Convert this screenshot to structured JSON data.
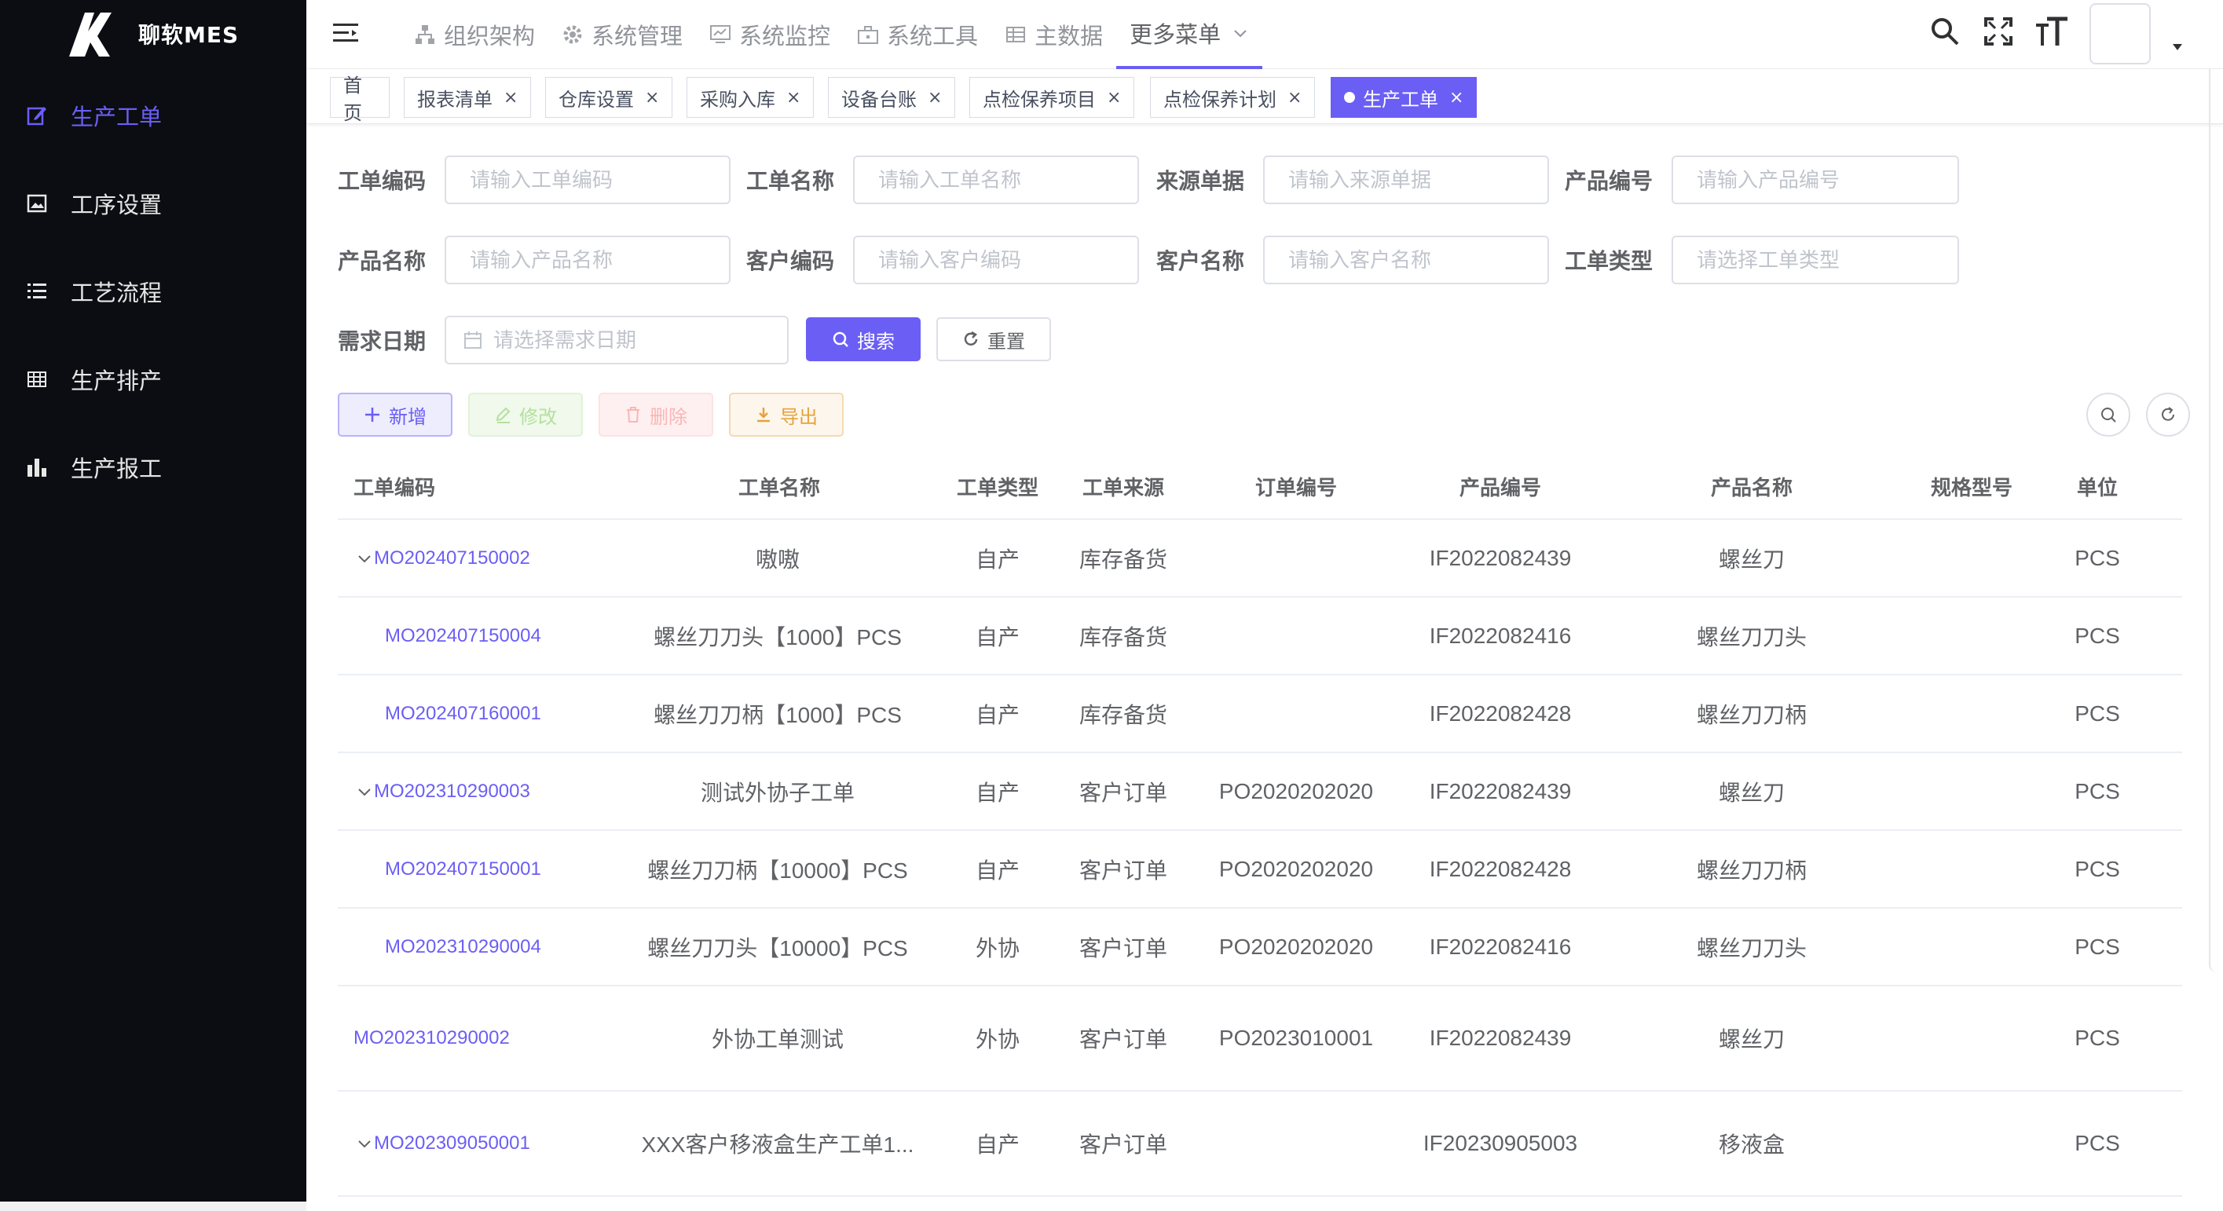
{
  "app": {
    "title": "聊软MES"
  },
  "sidebar": {
    "items": [
      {
        "label": "生产工单",
        "icon": "edit-icon",
        "active": true
      },
      {
        "label": "工序设置",
        "icon": "image-icon",
        "active": false
      },
      {
        "label": "工艺流程",
        "icon": "list-icon",
        "active": false
      },
      {
        "label": "生产排产",
        "icon": "table-icon",
        "active": false
      },
      {
        "label": "生产报工",
        "icon": "chart-icon",
        "active": false
      }
    ]
  },
  "navbar": {
    "menu": [
      {
        "label": "组织架构",
        "icon": "tree-icon"
      },
      {
        "label": "系统管理",
        "icon": "gear-icon"
      },
      {
        "label": "系统监控",
        "icon": "monitor-icon"
      },
      {
        "label": "系统工具",
        "icon": "toolbox-icon"
      },
      {
        "label": "主数据",
        "icon": "table-icon"
      },
      {
        "label": "更多菜单",
        "icon": "chevron-down-icon"
      }
    ],
    "right_icons": [
      "search-icon",
      "fullscreen-icon",
      "font-size-icon"
    ]
  },
  "tags": [
    {
      "label": "首页",
      "closable": false,
      "active": false
    },
    {
      "label": "报表清单",
      "closable": true,
      "active": false
    },
    {
      "label": "仓库设置",
      "closable": true,
      "active": false
    },
    {
      "label": "采购入库",
      "closable": true,
      "active": false
    },
    {
      "label": "设备台账",
      "closable": true,
      "active": false
    },
    {
      "label": "点检保养项目",
      "closable": true,
      "active": false
    },
    {
      "label": "点检保养计划",
      "closable": true,
      "active": false
    },
    {
      "label": "生产工单",
      "closable": true,
      "active": true
    }
  ],
  "tag_close": "×",
  "form": {
    "fields": [
      {
        "label": "工单编码",
        "placeholder": "请输入工单编码",
        "value": ""
      },
      {
        "label": "工单名称",
        "placeholder": "请输入工单名称",
        "value": ""
      },
      {
        "label": "来源单据",
        "placeholder": "请输入来源单据",
        "value": ""
      },
      {
        "label": "产品编号",
        "placeholder": "请输入产品编号",
        "value": ""
      },
      {
        "label": "产品名称",
        "placeholder": "请输入产品名称",
        "value": ""
      },
      {
        "label": "客户编码",
        "placeholder": "请输入客户编码",
        "value": ""
      },
      {
        "label": "客户名称",
        "placeholder": "请输入客户名称",
        "value": ""
      },
      {
        "label": "工单类型",
        "placeholder": "请选择工单类型",
        "value": ""
      }
    ],
    "date": {
      "label": "需求日期",
      "placeholder": "请选择需求日期"
    },
    "search_label": "搜索",
    "reset_label": "重置"
  },
  "toolbar": {
    "add_label": "新增",
    "edit_label": "修改",
    "delete_label": "删除",
    "export_label": "导出"
  },
  "table": {
    "columns": [
      "工单编码",
      "工单名称",
      "工单类型",
      "工单来源",
      "订单编号",
      "产品编号",
      "产品名称",
      "规格型号",
      "单位"
    ],
    "rows": [
      {
        "code": "MO202407150002",
        "name": "嗷嗷",
        "type": "自产",
        "source": "库存备货",
        "order": "",
        "product_code": "IF2022082439",
        "product_name": "螺丝刀",
        "spec": "",
        "unit": "PCS",
        "expandable": true,
        "level": 0
      },
      {
        "code": "MO202407150004",
        "name": "螺丝刀刀头【1000】PCS",
        "type": "自产",
        "source": "库存备货",
        "order": "",
        "product_code": "IF2022082416",
        "product_name": "螺丝刀刀头",
        "spec": "",
        "unit": "PCS",
        "expandable": false,
        "level": 1
      },
      {
        "code": "MO202407160001",
        "name": "螺丝刀刀柄【1000】PCS",
        "type": "自产",
        "source": "库存备货",
        "order": "",
        "product_code": "IF2022082428",
        "product_name": "螺丝刀刀柄",
        "spec": "",
        "unit": "PCS",
        "expandable": false,
        "level": 1
      },
      {
        "code": "MO202310290003",
        "name": "测试外协子工单",
        "type": "自产",
        "source": "客户订单",
        "order": "PO2020202020",
        "product_code": "IF2022082439",
        "product_name": "螺丝刀",
        "spec": "",
        "unit": "PCS",
        "expandable": true,
        "level": 0
      },
      {
        "code": "MO202407150001",
        "name": "螺丝刀刀柄【10000】PCS",
        "type": "自产",
        "source": "客户订单",
        "order": "PO2020202020",
        "product_code": "IF2022082428",
        "product_name": "螺丝刀刀柄",
        "spec": "",
        "unit": "PCS",
        "expandable": false,
        "level": 1
      },
      {
        "code": "MO202310290004",
        "name": "螺丝刀刀头【10000】PCS",
        "type": "外协",
        "source": "客户订单",
        "order": "PO2020202020",
        "product_code": "IF2022082416",
        "product_name": "螺丝刀刀头",
        "spec": "",
        "unit": "PCS",
        "expandable": false,
        "level": 1
      },
      {
        "code": "MO202310290002",
        "name": "外协工单测试",
        "type": "外协",
        "source": "客户订单",
        "order": "PO2023010001",
        "product_code": "IF2022082439",
        "product_name": "螺丝刀",
        "spec": "",
        "unit": "PCS",
        "expandable": false,
        "level": -1
      },
      {
        "code": "MO202309050001",
        "name": "XXX客户移液盒生产工单1...",
        "type": "自产",
        "source": "客户订单",
        "order": "",
        "product_code": "IF20230905003",
        "product_name": "移液盒",
        "spec": "",
        "unit": "PCS",
        "expandable": true,
        "level": 0
      }
    ]
  },
  "colors": {
    "accent": "#6b5ef5",
    "sidebar_bg": "#0b0d12"
  }
}
